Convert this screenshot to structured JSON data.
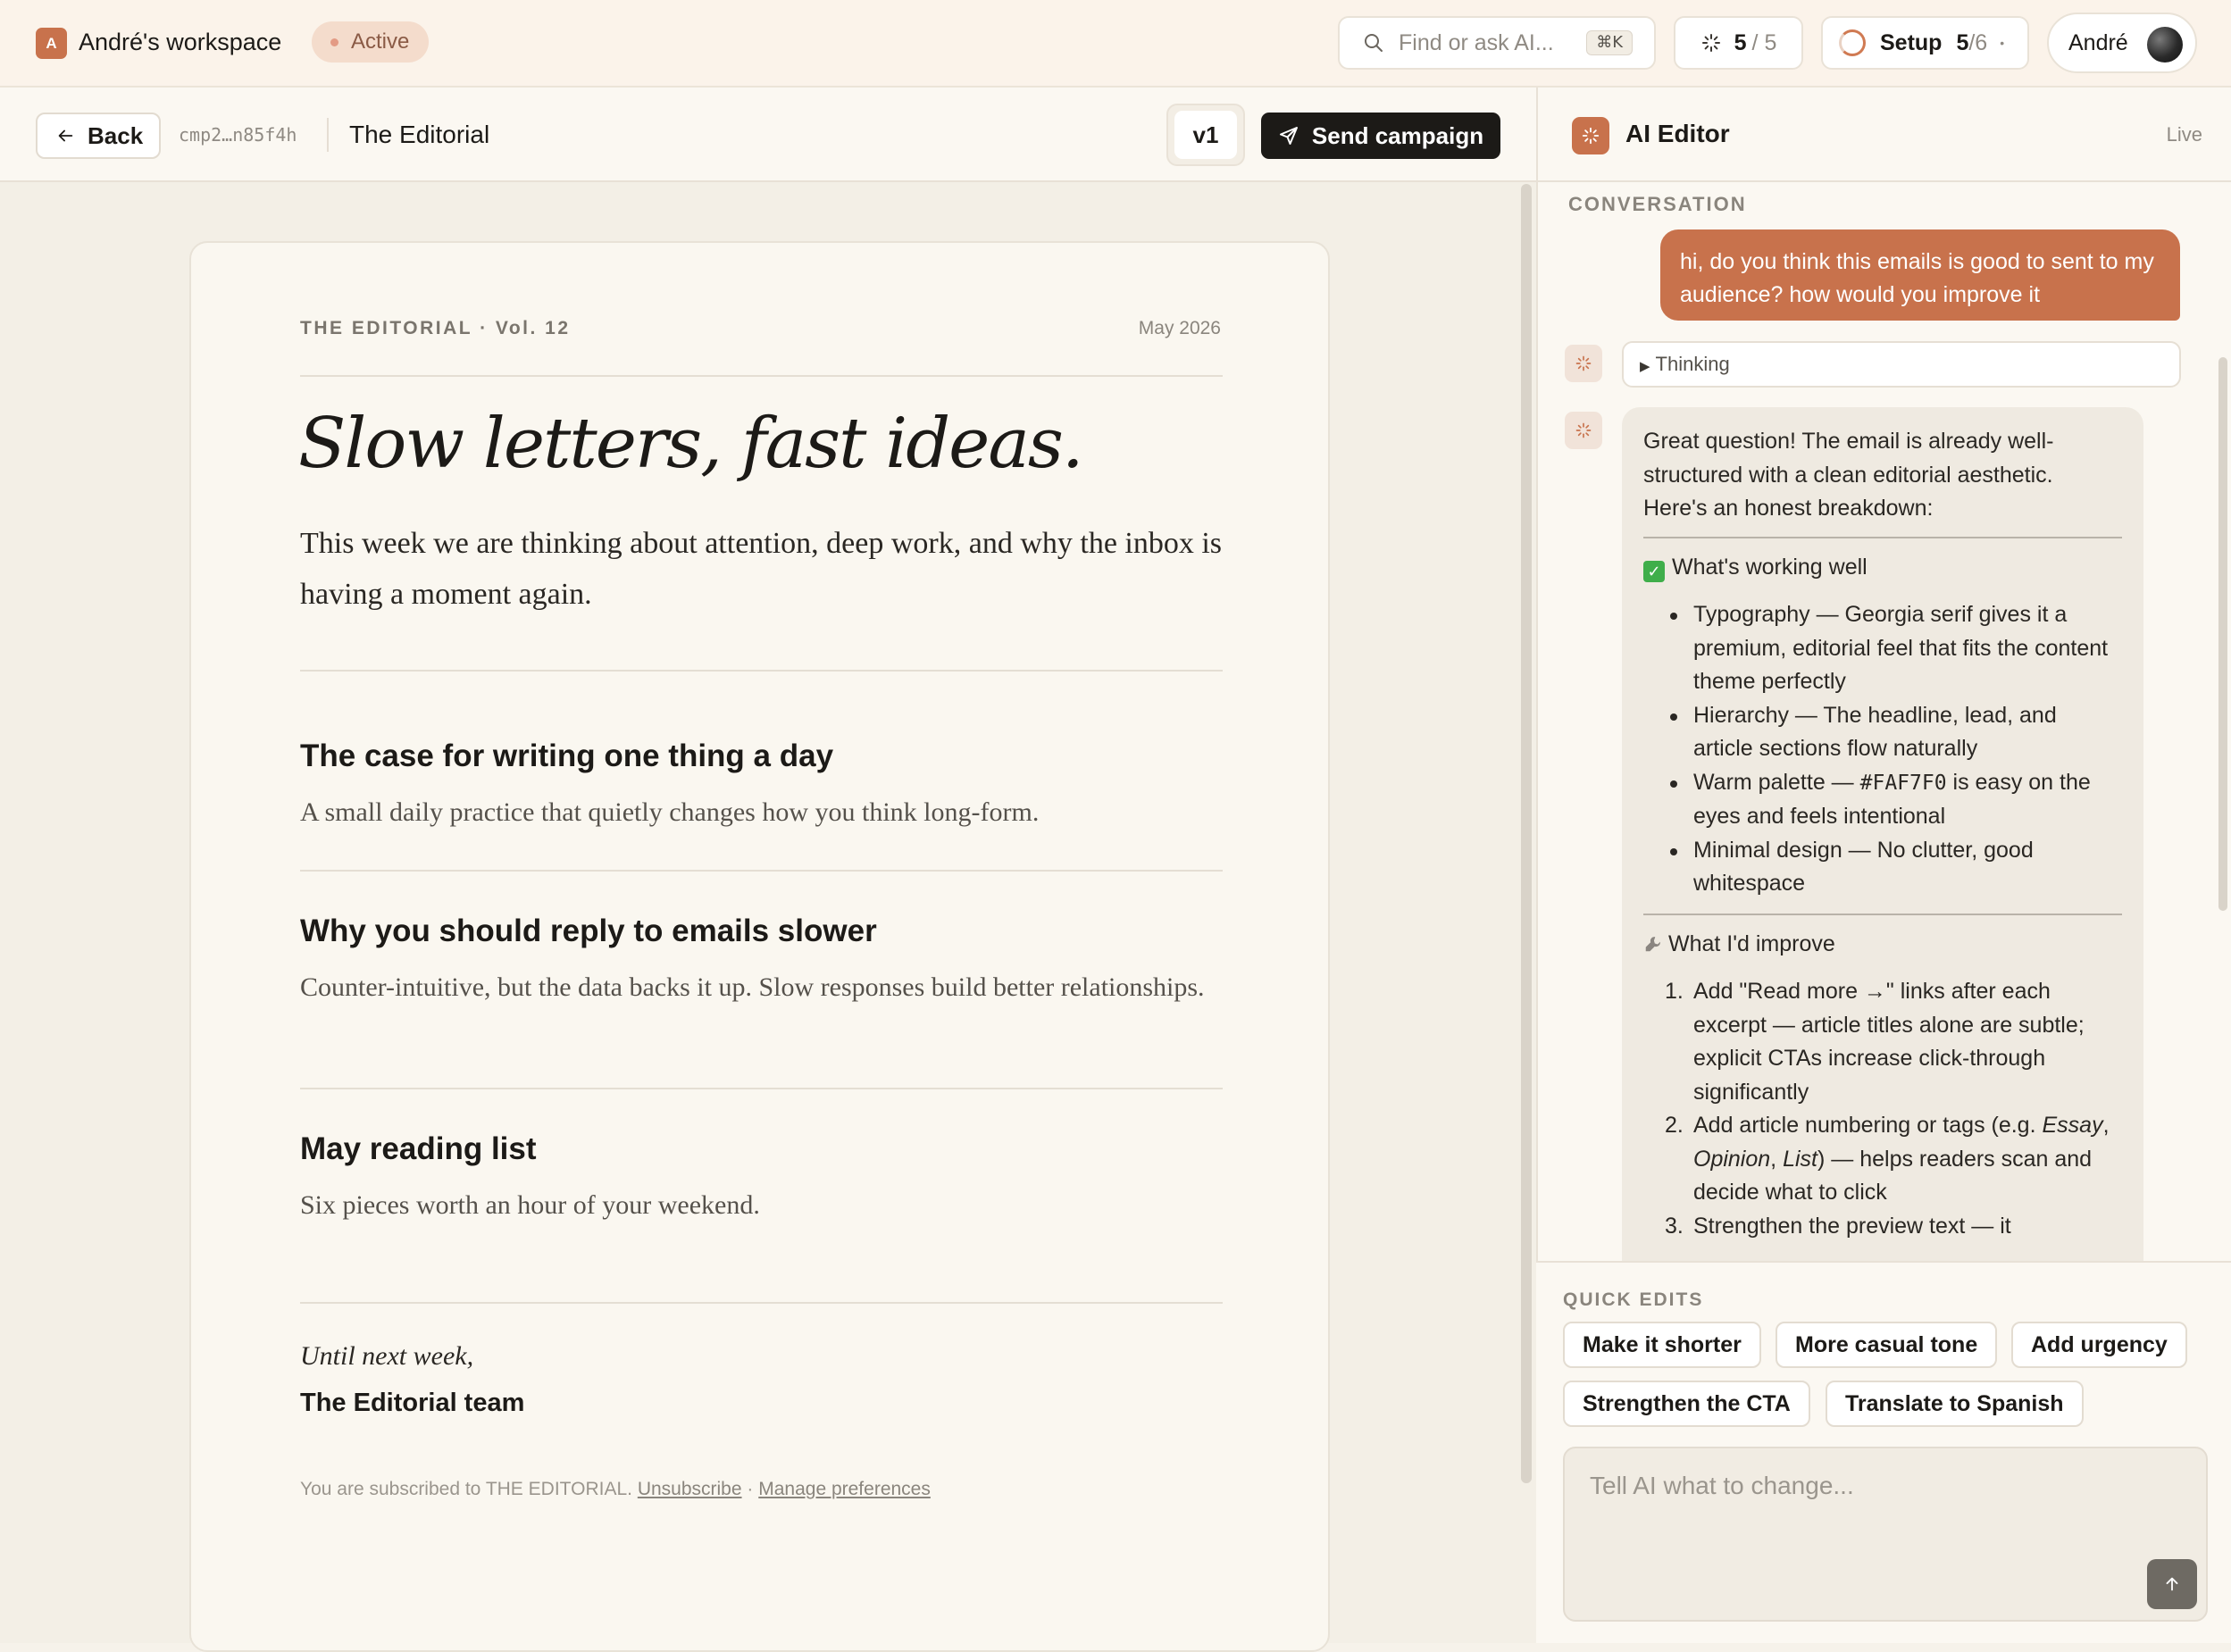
{
  "topbar": {
    "workspace_initial": "A",
    "workspace_name": "André's workspace",
    "status": "Active",
    "search_placeholder": "Find or ask AI...",
    "search_shortcut": "⌘K",
    "credits_used": "5",
    "credits_sep": "/ 5",
    "setup_label": "Setup",
    "setup_done": "5",
    "setup_total": "/6",
    "setup_progress": 0.833,
    "setup_dot": "•",
    "user_name": "André"
  },
  "editor": {
    "back_label": "Back",
    "campaign_id": "cmp2…n85f4h",
    "campaign_name": "The Editorial",
    "version": "v1",
    "send_label": "Send campaign"
  },
  "email": {
    "brand": "THE EDITORIAL · Vol. 12",
    "date": "May 2026",
    "headline": "Slow letters, fast ideas.",
    "lead": "This week we are thinking about attention, deep work, and why the inbox is having a moment again.",
    "articles": [
      {
        "title": "The case for writing one thing a day",
        "excerpt": "A small daily practice that quietly changes how you think long-form."
      },
      {
        "title": "Why you should reply to emails slower",
        "excerpt": "Counter-intuitive, but the data backs it up. Slow responses build better relationships."
      },
      {
        "title": "May reading list",
        "excerpt": "Six pieces worth an hour of your weekend."
      }
    ],
    "signoff": "Until next week,",
    "team": "The Editorial team",
    "footer_text": "You are subscribed to THE EDITORIAL.",
    "unsubscribe": "Unsubscribe",
    "footer_sep": "·",
    "manage": "Manage preferences"
  },
  "ai": {
    "title": "AI Editor",
    "live": "Live",
    "conversation_label": "CONVERSATION",
    "user_message": "hi, do you think this emails is good to sent to my audience? how would you improve it",
    "thinking_label": "Thinking",
    "reply_intro": "Great question! The email is already well-structured with a clean editorial aesthetic. Here's an honest breakdown:",
    "working_title": "What's working well",
    "working_items": [
      "Typography — Georgia serif gives it a premium, editorial feel that fits the content theme perfectly",
      "Hierarchy — The headline, lead, and article sections flow naturally",
      "Minimal design — No clutter, good whitespace"
    ],
    "palette_pre": "Warm palette — ",
    "palette_code": "#FAF7F0",
    "palette_post": " is easy on the eyes and feels intentional",
    "improve_title": "What I'd improve",
    "improve_1": "Add \"Read more →\" links after each excerpt — article titles alone are subtle; explicit CTAs increase click-through significantly",
    "improve_2_pre": "Add article numbering or tags (e.g. ",
    "improve_2_e1": "Essay",
    "improve_2_c1": ", ",
    "improve_2_e2": "Opinion",
    "improve_2_c2": ", ",
    "improve_2_e3": "List",
    "improve_2_post": ") — helps readers scan and decide what to click",
    "improve_3": "Strengthen the preview text — it",
    "num_1": "1.",
    "num_2": "2.",
    "num_3": "3."
  },
  "quick": {
    "label": "QUICK EDITS",
    "chips": [
      "Make it shorter",
      "More casual tone",
      "Add urgency",
      "Strengthen the CTA",
      "Translate to Spanish"
    ],
    "prompt_placeholder": "Tell AI what to change..."
  },
  "colors": {
    "accent": "#c8724c",
    "dark": "#1c1a17",
    "background": "#f6f2ea"
  }
}
